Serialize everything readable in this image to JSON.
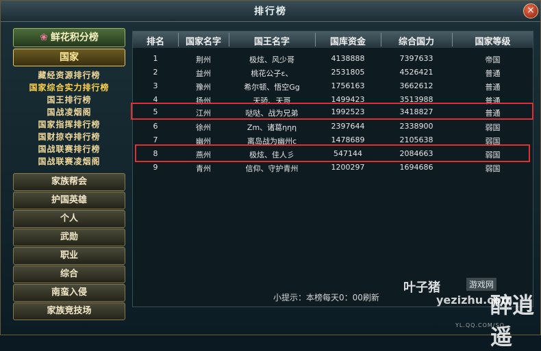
{
  "window": {
    "title": "排行榜",
    "close_label": "×"
  },
  "sidebar": {
    "header": "鲜花积分榜",
    "active_category": "国家",
    "sub_items": [
      "藏经资源排行榜",
      "国家综合实力排行榜",
      "国王排行榜",
      "国战凌烟阁",
      "国家指挥排行榜",
      "国财掠夺排行榜",
      "国战联赛排行榜",
      "国战联赛凌烟阁"
    ],
    "categories": [
      "家族帮会",
      "护国英雄",
      "个人",
      "武勋",
      "职业",
      "综合",
      "南蛮入侵",
      "家族竞技场"
    ]
  },
  "table": {
    "headers": [
      "排名",
      "国家名字",
      "国王名字",
      "国库资金",
      "综合国力",
      "国家等级"
    ],
    "rows": [
      [
        "1",
        "荆州",
        "极炫、风少哥",
        "4138888",
        "7397633",
        "帝国"
      ],
      [
        "2",
        "益州",
        "桃花公子ε、",
        "2531805",
        "4526421",
        "普通"
      ],
      [
        "3",
        "豫州",
        "希尔顿、悟空Gg",
        "1756163",
        "3662612",
        "普通"
      ],
      [
        "4",
        "扬州",
        "天骄、天哥",
        "1499423",
        "3513988",
        "普通"
      ],
      [
        "5",
        "江州",
        "哒哒、战为兄弟",
        "1992523",
        "3418827",
        "普通"
      ],
      [
        "6",
        "徐州",
        "Zm、诸葛ηηη",
        "2397644",
        "2338900",
        "弱国"
      ],
      [
        "7",
        "幽州",
        "离岛战为幽州c",
        "1478689",
        "2105638",
        "弱国"
      ],
      [
        "8",
        "燕州",
        "极炫、佳人彡",
        "547144",
        "2084663",
        "弱国"
      ],
      [
        "9",
        "青州",
        "信仰、守护青州",
        "1200297",
        "1694686",
        "弱国"
      ]
    ]
  },
  "tip": "小提示：本榜每天0：00刷新",
  "watermark": {
    "brand": "叶子猪",
    "site": "游戏网",
    "domain": "yezizhu.com",
    "game": "醉逍遥",
    "url": "YL.QQ.COM/SQ"
  }
}
